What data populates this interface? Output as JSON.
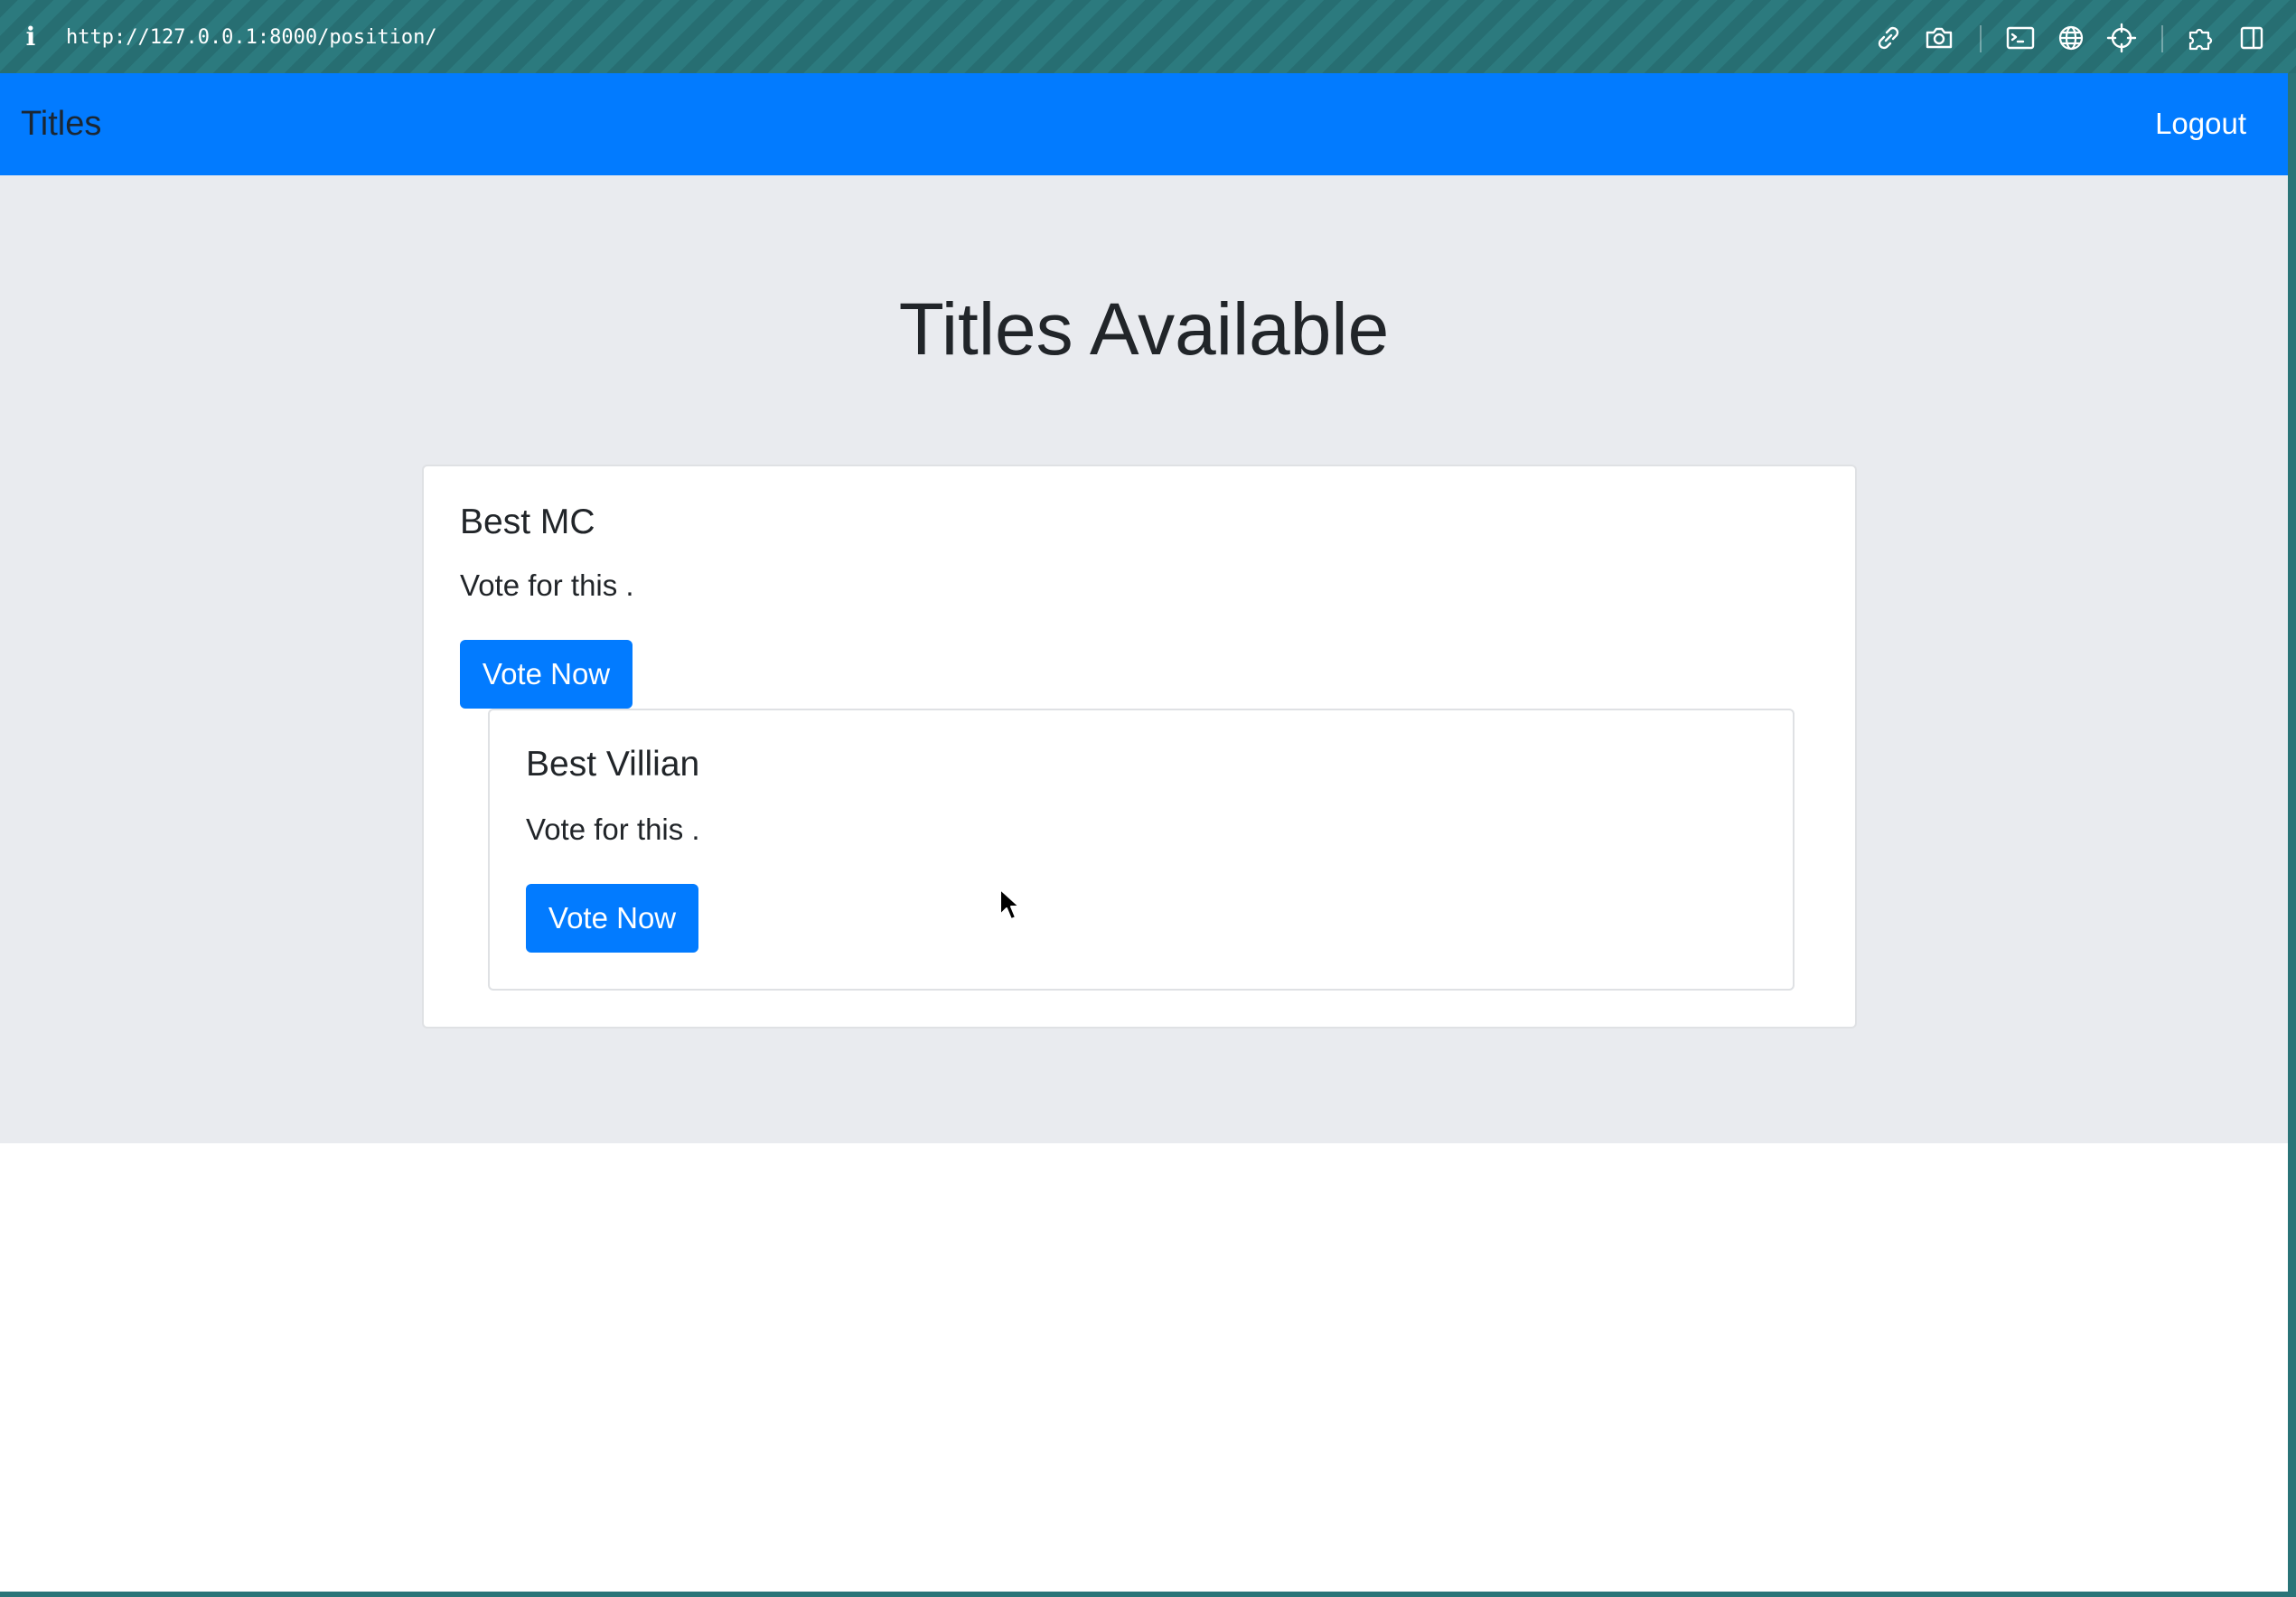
{
  "browser": {
    "url": "http://127.0.0.1:8000/position/",
    "icons": [
      "info-icon",
      "link-icon",
      "camera-icon",
      "terminal-icon",
      "globe-icon",
      "crosshair-icon",
      "puzzle-icon",
      "sidebar-icon"
    ]
  },
  "navbar": {
    "brand": "Titles",
    "logout_label": "Logout",
    "color": "#027bff"
  },
  "main": {
    "title": "Titles Available",
    "cards": [
      {
        "title": "Best MC",
        "text": "Vote for this .",
        "button_label": "Vote Now"
      },
      {
        "title": "Best Villian",
        "text": "Vote for this .",
        "button_label": "Vote Now"
      }
    ]
  },
  "colors": {
    "primary": "#027bff",
    "jumbotron_bg": "#e9ebef",
    "toolbar_bg": "#276e72"
  }
}
